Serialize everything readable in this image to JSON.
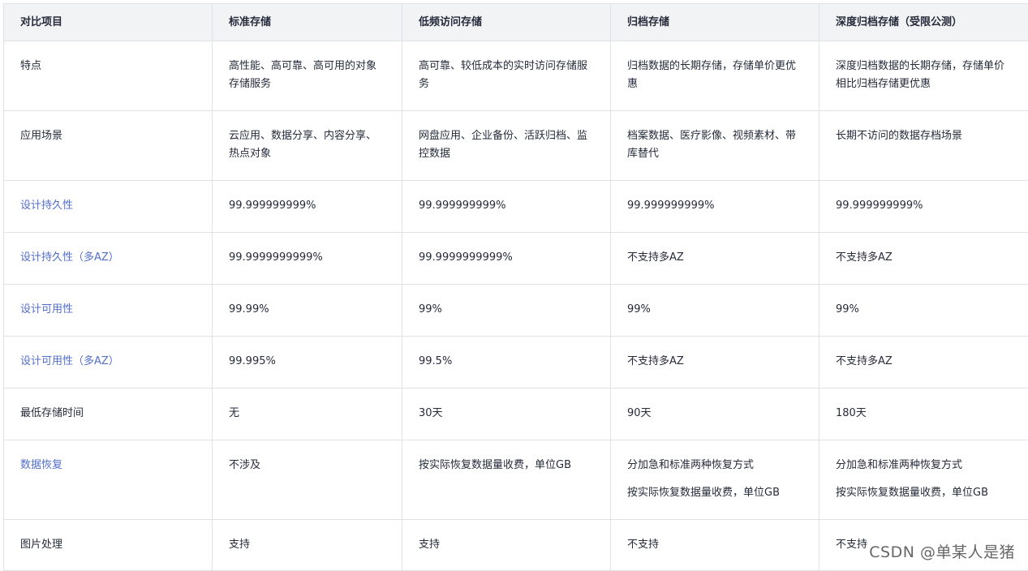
{
  "table": {
    "headers": [
      "对比项目",
      "标准存储",
      "低频访问存储",
      "归档存储",
      "深度归档存储（受限公测）"
    ],
    "rows": [
      {
        "label": "特点",
        "link": false,
        "cells": [
          [
            "高性能、高可靠、高可用的对象存储服务"
          ],
          [
            "高可靠、较低成本的实时访问存储服务"
          ],
          [
            "归档数据的长期存储，存储单价更优惠"
          ],
          [
            "深度归档数据的长期存储，存储单价相比归档存储更优惠"
          ]
        ]
      },
      {
        "label": "应用场景",
        "link": false,
        "cells": [
          [
            "云应用、数据分享、内容分享、热点对象"
          ],
          [
            "网盘应用、企业备份、活跃归档、监控数据"
          ],
          [
            "档案数据、医疗影像、视频素材、带库替代"
          ],
          [
            "长期不访问的数据存档场景"
          ]
        ]
      },
      {
        "label": "设计持久性",
        "link": true,
        "cells": [
          [
            "99.999999999%"
          ],
          [
            "99.999999999%"
          ],
          [
            "99.999999999%"
          ],
          [
            "99.999999999%"
          ]
        ]
      },
      {
        "label": "设计持久性（多AZ）",
        "link": true,
        "cells": [
          [
            "99.9999999999%"
          ],
          [
            "99.9999999999%"
          ],
          [
            "不支持多AZ"
          ],
          [
            "不支持多AZ"
          ]
        ]
      },
      {
        "label": "设计可用性",
        "link": true,
        "cells": [
          [
            "99.99%"
          ],
          [
            "99%"
          ],
          [
            "99%"
          ],
          [
            "99%"
          ]
        ]
      },
      {
        "label": "设计可用性（多AZ）",
        "link": true,
        "cells": [
          [
            "99.995%"
          ],
          [
            "99.5%"
          ],
          [
            "不支持多AZ"
          ],
          [
            "不支持多AZ"
          ]
        ]
      },
      {
        "label": "最低存储时间",
        "link": false,
        "cells": [
          [
            "无"
          ],
          [
            "30天"
          ],
          [
            "90天"
          ],
          [
            "180天"
          ]
        ]
      },
      {
        "label": "数据恢复",
        "link": true,
        "cells": [
          [
            "不涉及"
          ],
          [
            "按实际恢复数据量收费，单位GB"
          ],
          [
            "分加急和标准两种恢复方式",
            "按实际恢复数据量收费，单位GB"
          ],
          [
            "分加急和标准两种恢复方式",
            "按实际恢复数据量收费，单位GB"
          ]
        ]
      },
      {
        "label": "图片处理",
        "link": false,
        "cells": [
          [
            "支持"
          ],
          [
            "支持"
          ],
          [
            "不支持"
          ],
          [
            "不支持"
          ]
        ]
      }
    ]
  },
  "watermark": "CSDN @单某人是猪",
  "colors": {
    "header_bg": "#f2f3f5",
    "border": "#dfe1e6",
    "link_text": "#526ecc",
    "body_text": "#252b3a"
  }
}
